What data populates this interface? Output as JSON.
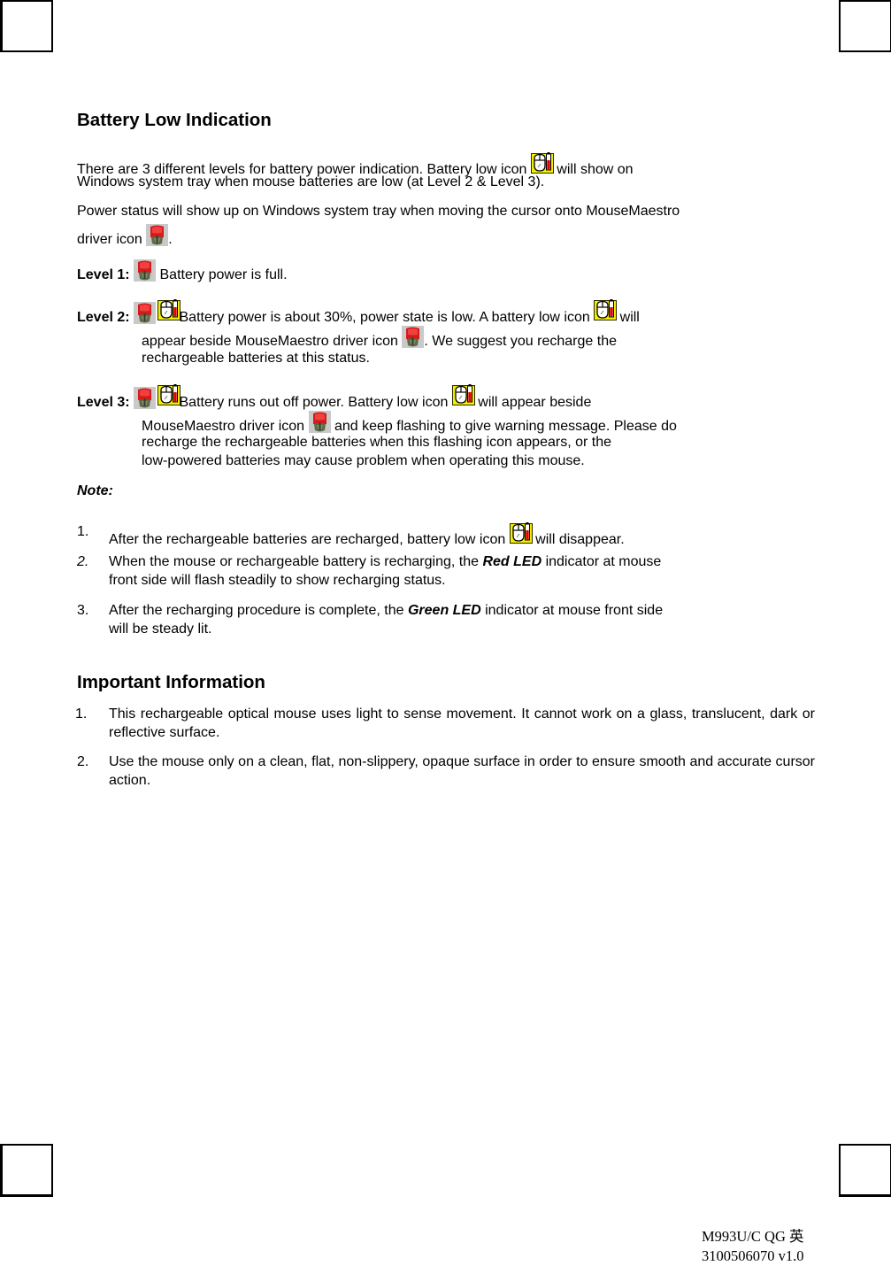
{
  "section1": {
    "title": "Battery Low Indication",
    "intro_line1_a": "There are 3 different levels for battery power indication. Battery low icon ",
    "intro_line1_b": " will show on",
    "intro_line2": "Windows system tray when mouse batteries are low (at Level 2 & Level 3).",
    "power_line1": "Power status will show up on Windows system tray when moving the cursor onto MouseMaestro",
    "power_line2_a": "driver icon ",
    "power_line2_b": "."
  },
  "levels": [
    {
      "label": "Level 1:",
      "line1": " Battery power is full."
    },
    {
      "label": "Level 2:",
      "line1_a": "Battery power is about 30%, power state is low. A battery low icon ",
      "line1_b": " will",
      "line2_a": "appear beside MouseMaestro driver icon ",
      "line2_b": ". We suggest you recharge the",
      "line3": "rechargeable batteries at this status."
    },
    {
      "label": "Level 3:",
      "line1_a": "Battery runs out off power. Battery low icon ",
      "line1_b": " will appear beside",
      "line2_a": "MouseMaestro driver icon ",
      "line2_b": " and keep flashing to give warning message. Please do",
      "line3": "recharge the rechargeable batteries when this flashing icon appears, or the",
      "line4": "low-powered batteries may cause problem when operating this mouse."
    }
  ],
  "note": {
    "title": "Note:",
    "items": [
      {
        "num": "1.",
        "line1_a": "After the rechargeable batteries are recharged, battery low icon ",
        "line1_b": " will disappear."
      },
      {
        "num": "2.",
        "line1_a": "When the mouse or rechargeable battery is recharging, the ",
        "emph": "Red LED",
        "line1_b": " indicator at mouse",
        "line2": "front side will flash steadily to show recharging status."
      },
      {
        "num": "3.",
        "line1_a": "After the recharging procedure is complete, the ",
        "emph": "Green LED",
        "line1_b": " indicator at mouse front side",
        "line2": "will be steady lit."
      }
    ]
  },
  "important": {
    "title": "Important Information",
    "items": [
      {
        "num": "1.",
        "text": "This rechargeable optical mouse uses light to sense movement. It cannot work on a glass, translucent, dark or reflective surface."
      },
      {
        "num": "2.",
        "text": "Use the mouse only on a clean, flat, non-slippery, opaque surface in order to ensure smooth and accurate cursor action."
      }
    ]
  },
  "footer": {
    "line1": "M993U/C QG 英",
    "line2": "3100506070 v1.0"
  },
  "icons": {
    "driver_icon": "mousemaestro-driver-icon",
    "battery_low_icon": "battery-low-icon"
  },
  "colors": {
    "battery_low_bg": "#f5f000",
    "battery_red": "#e00000",
    "driver_red": "#d81818",
    "driver_bg": "#c8c8c8"
  }
}
